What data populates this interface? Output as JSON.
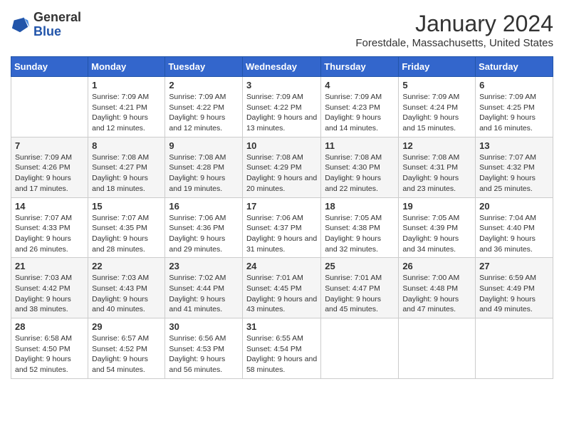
{
  "logo": {
    "general": "General",
    "blue": "Blue"
  },
  "title": "January 2024",
  "location": "Forestdale, Massachusetts, United States",
  "days_of_week": [
    "Sunday",
    "Monday",
    "Tuesday",
    "Wednesday",
    "Thursday",
    "Friday",
    "Saturday"
  ],
  "weeks": [
    [
      {
        "num": "",
        "info": ""
      },
      {
        "num": "1",
        "info": "Sunrise: 7:09 AM\nSunset: 4:21 PM\nDaylight: 9 hours and 12 minutes."
      },
      {
        "num": "2",
        "info": "Sunrise: 7:09 AM\nSunset: 4:22 PM\nDaylight: 9 hours and 12 minutes."
      },
      {
        "num": "3",
        "info": "Sunrise: 7:09 AM\nSunset: 4:22 PM\nDaylight: 9 hours and 13 minutes."
      },
      {
        "num": "4",
        "info": "Sunrise: 7:09 AM\nSunset: 4:23 PM\nDaylight: 9 hours and 14 minutes."
      },
      {
        "num": "5",
        "info": "Sunrise: 7:09 AM\nSunset: 4:24 PM\nDaylight: 9 hours and 15 minutes."
      },
      {
        "num": "6",
        "info": "Sunrise: 7:09 AM\nSunset: 4:25 PM\nDaylight: 9 hours and 16 minutes."
      }
    ],
    [
      {
        "num": "7",
        "info": "Sunrise: 7:09 AM\nSunset: 4:26 PM\nDaylight: 9 hours and 17 minutes."
      },
      {
        "num": "8",
        "info": "Sunrise: 7:08 AM\nSunset: 4:27 PM\nDaylight: 9 hours and 18 minutes."
      },
      {
        "num": "9",
        "info": "Sunrise: 7:08 AM\nSunset: 4:28 PM\nDaylight: 9 hours and 19 minutes."
      },
      {
        "num": "10",
        "info": "Sunrise: 7:08 AM\nSunset: 4:29 PM\nDaylight: 9 hours and 20 minutes."
      },
      {
        "num": "11",
        "info": "Sunrise: 7:08 AM\nSunset: 4:30 PM\nDaylight: 9 hours and 22 minutes."
      },
      {
        "num": "12",
        "info": "Sunrise: 7:08 AM\nSunset: 4:31 PM\nDaylight: 9 hours and 23 minutes."
      },
      {
        "num": "13",
        "info": "Sunrise: 7:07 AM\nSunset: 4:32 PM\nDaylight: 9 hours and 25 minutes."
      }
    ],
    [
      {
        "num": "14",
        "info": "Sunrise: 7:07 AM\nSunset: 4:33 PM\nDaylight: 9 hours and 26 minutes."
      },
      {
        "num": "15",
        "info": "Sunrise: 7:07 AM\nSunset: 4:35 PM\nDaylight: 9 hours and 28 minutes."
      },
      {
        "num": "16",
        "info": "Sunrise: 7:06 AM\nSunset: 4:36 PM\nDaylight: 9 hours and 29 minutes."
      },
      {
        "num": "17",
        "info": "Sunrise: 7:06 AM\nSunset: 4:37 PM\nDaylight: 9 hours and 31 minutes."
      },
      {
        "num": "18",
        "info": "Sunrise: 7:05 AM\nSunset: 4:38 PM\nDaylight: 9 hours and 32 minutes."
      },
      {
        "num": "19",
        "info": "Sunrise: 7:05 AM\nSunset: 4:39 PM\nDaylight: 9 hours and 34 minutes."
      },
      {
        "num": "20",
        "info": "Sunrise: 7:04 AM\nSunset: 4:40 PM\nDaylight: 9 hours and 36 minutes."
      }
    ],
    [
      {
        "num": "21",
        "info": "Sunrise: 7:03 AM\nSunset: 4:42 PM\nDaylight: 9 hours and 38 minutes."
      },
      {
        "num": "22",
        "info": "Sunrise: 7:03 AM\nSunset: 4:43 PM\nDaylight: 9 hours and 40 minutes."
      },
      {
        "num": "23",
        "info": "Sunrise: 7:02 AM\nSunset: 4:44 PM\nDaylight: 9 hours and 41 minutes."
      },
      {
        "num": "24",
        "info": "Sunrise: 7:01 AM\nSunset: 4:45 PM\nDaylight: 9 hours and 43 minutes."
      },
      {
        "num": "25",
        "info": "Sunrise: 7:01 AM\nSunset: 4:47 PM\nDaylight: 9 hours and 45 minutes."
      },
      {
        "num": "26",
        "info": "Sunrise: 7:00 AM\nSunset: 4:48 PM\nDaylight: 9 hours and 47 minutes."
      },
      {
        "num": "27",
        "info": "Sunrise: 6:59 AM\nSunset: 4:49 PM\nDaylight: 9 hours and 49 minutes."
      }
    ],
    [
      {
        "num": "28",
        "info": "Sunrise: 6:58 AM\nSunset: 4:50 PM\nDaylight: 9 hours and 52 minutes."
      },
      {
        "num": "29",
        "info": "Sunrise: 6:57 AM\nSunset: 4:52 PM\nDaylight: 9 hours and 54 minutes."
      },
      {
        "num": "30",
        "info": "Sunrise: 6:56 AM\nSunset: 4:53 PM\nDaylight: 9 hours and 56 minutes."
      },
      {
        "num": "31",
        "info": "Sunrise: 6:55 AM\nSunset: 4:54 PM\nDaylight: 9 hours and 58 minutes."
      },
      {
        "num": "",
        "info": ""
      },
      {
        "num": "",
        "info": ""
      },
      {
        "num": "",
        "info": ""
      }
    ]
  ]
}
